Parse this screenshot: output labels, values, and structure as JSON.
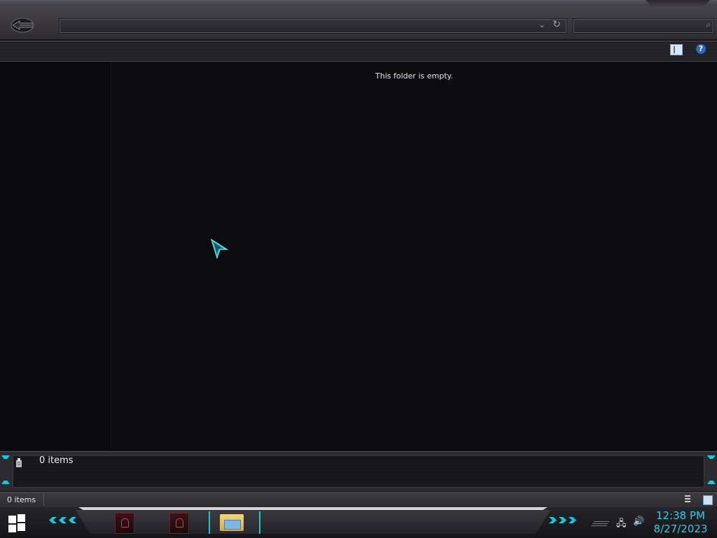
{
  "window": {
    "address_value": "",
    "search_placeholder": "",
    "empty_message": "This folder is empty."
  },
  "details_pane": {
    "item_count": "0 items"
  },
  "status_bar": {
    "item_count": "0 items"
  },
  "taskbar": {
    "pinned_apps": [
      "red-app-icon",
      "red-app-icon",
      "file-explorer-icon"
    ],
    "clock": {
      "time": "12:38 PM",
      "date": "8/27/2023"
    }
  },
  "colors": {
    "accent": "#2ad0e0",
    "background": "#0c0c0f",
    "chrome": "#3a383d"
  }
}
